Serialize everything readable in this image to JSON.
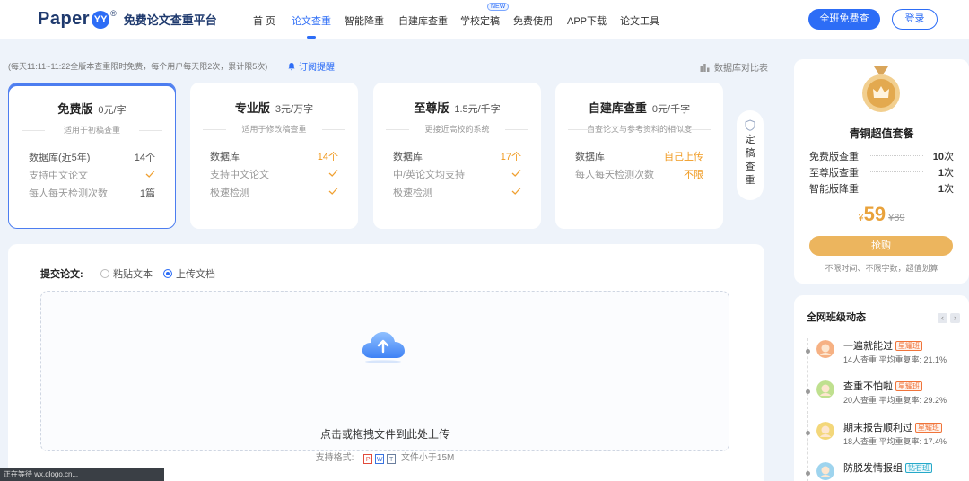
{
  "header": {
    "logo_word": "Paper",
    "logo_badge": "YY",
    "logo_reg": "®",
    "logo_title": "免费论文查重平台",
    "nav": [
      "首 页",
      "论文查重",
      "智能降重",
      "自建库查重",
      "学校定稿",
      "免费使用",
      "APP下载",
      "论文工具"
    ],
    "nav_new_tag": "NEW",
    "free_button": "全班免费查",
    "login_button": "登录"
  },
  "notice": {
    "text": "(每天11:11~11:22全版本查重限时免费，每个用户每天限2次，累计限5次)",
    "subscribe": "订阅提醒",
    "compare": "数据库对比表"
  },
  "cards": [
    {
      "name": "免费版",
      "price": "0元/字",
      "sub": "适用于初稿查重",
      "features": [
        {
          "label": "数据库(近5年)",
          "value": "14个",
          "kind": "text"
        },
        {
          "label": "支持中文论文",
          "value": "",
          "kind": "check"
        },
        {
          "label": "每人每天检测次数",
          "value": "1篇",
          "kind": "text"
        }
      ]
    },
    {
      "name": "专业版",
      "price": "3元/万字",
      "sub": "适用于修改稿查重",
      "features": [
        {
          "label": "数据库",
          "value": "14个",
          "kind": "orange"
        },
        {
          "label": "支持中文论文",
          "value": "",
          "kind": "check"
        },
        {
          "label": "极速检测",
          "value": "",
          "kind": "check"
        }
      ]
    },
    {
      "name": "至尊版",
      "price": "1.5元/千字",
      "sub": "更接近高校的系统",
      "features": [
        {
          "label": "数据库",
          "value": "17个",
          "kind": "orange"
        },
        {
          "label": "中/英论文均支持",
          "value": "",
          "kind": "check"
        },
        {
          "label": "极速检测",
          "value": "",
          "kind": "check"
        }
      ]
    },
    {
      "name": "自建库查重",
      "price": "0元/千字",
      "sub": "自查论文与参考资料的相似度",
      "features": [
        {
          "label": "数据库",
          "value": "自己上传",
          "kind": "orange"
        },
        {
          "label": "每人每天检测次数",
          "value": "不限",
          "kind": "orange"
        }
      ]
    }
  ],
  "side_strip": "定稿查重",
  "upload": {
    "label": "提交论文:",
    "paste_option": "粘贴文本",
    "upload_option": "上传文档",
    "selected": "upload",
    "drop_text": "点击或拖拽文件到此处上传",
    "formats_label": "支持格式:",
    "formats": [
      "P",
      "W",
      "T"
    ],
    "size_text": "文件小于15M"
  },
  "package": {
    "title": "青铜超值套餐",
    "rows": [
      {
        "label": "免费版查重",
        "count": "10",
        "unit": "次"
      },
      {
        "label": "至尊版查重",
        "count": "1",
        "unit": "次"
      },
      {
        "label": "智能版降重",
        "count": "1",
        "unit": "次"
      }
    ],
    "currency": "¥",
    "price": "59",
    "old_price": "¥89",
    "buy": "抢购",
    "note": "不限时间、不限字数，超值划算"
  },
  "feed": {
    "title": "全网班级动态",
    "items": [
      {
        "name": "一遍就能过",
        "badge": "星耀班",
        "tier": "star",
        "meta": "14人查重  平均重复率: 21.1%"
      },
      {
        "name": "查重不怕啦",
        "badge": "星耀班",
        "tier": "star",
        "meta": "20人查重  平均重复率: 29.2%"
      },
      {
        "name": "期末报告顺利过",
        "badge": "星耀班",
        "tier": "star",
        "meta": "18人查重  平均重复率: 17.4%"
      },
      {
        "name": "防脱发情报组",
        "badge": "钻石班",
        "tier": "diamond",
        "meta": ""
      }
    ]
  },
  "status_bar": "正在等待 wx.qlogo.cn...",
  "colors": {
    "primary": "#2d6df6",
    "accent_orange": "#f09a20",
    "gold": "#e9a23b"
  }
}
